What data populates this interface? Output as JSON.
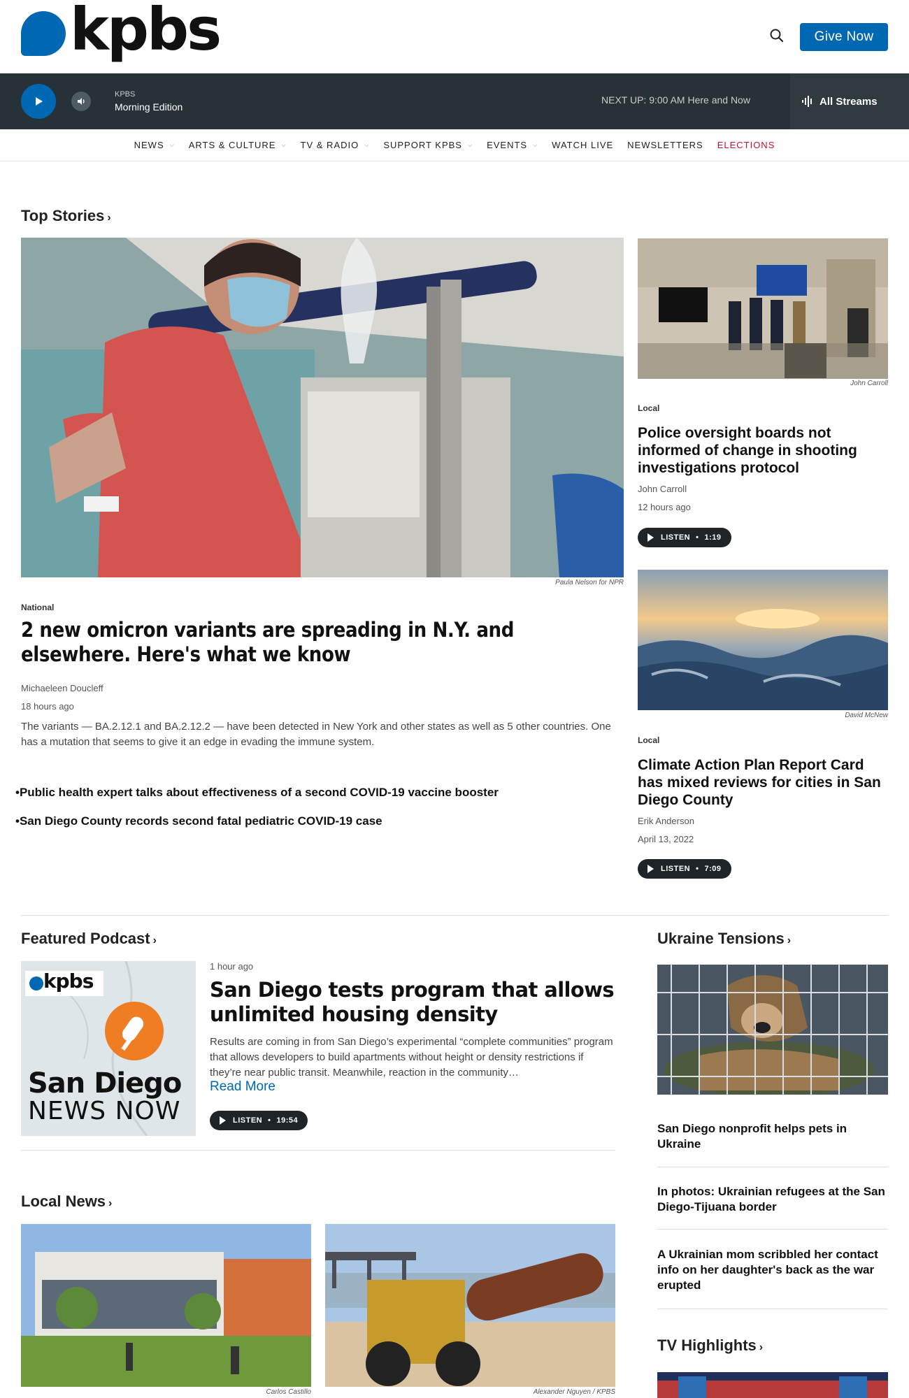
{
  "header": {
    "logo_text": "kpbs",
    "give_label": "Give Now"
  },
  "player": {
    "station": "KPBS",
    "program": "Morning Edition",
    "next_up_label": "NEXT UP:",
    "next_up_time": "9:00 AM",
    "next_up_show": "Here and Now",
    "all_streams_label": "All Streams"
  },
  "nav": {
    "items": [
      {
        "label": "NEWS",
        "has_menu": true
      },
      {
        "label": "ARTS & CULTURE",
        "has_menu": true
      },
      {
        "label": "TV & RADIO",
        "has_menu": true
      },
      {
        "label": "SUPPORT KPBS",
        "has_menu": true
      },
      {
        "label": "EVENTS",
        "has_menu": true
      },
      {
        "label": "WATCH LIVE",
        "has_menu": false
      },
      {
        "label": "NEWSLETTERS",
        "has_menu": false
      },
      {
        "label": "ELECTIONS",
        "has_menu": false
      }
    ]
  },
  "top_stories": {
    "heading": "Top Stories",
    "main": {
      "credit": "Paula Nelson for NPR",
      "tag": "National",
      "title": "2 new omicron variants are spreading in N.Y. and elsewhere. Here's what we know",
      "author": "Michaeleen Doucleff",
      "time": "18 hours ago",
      "teaser": "The variants — BA.2.12.1 and BA.2.12.2 — have been detected in New York and other states as well as 5 other countries. One has a mutation that seems to give it an edge in evading the immune system."
    },
    "related": [
      "Public health expert talks about effectiveness of a second COVID-19 vaccine booster",
      "San Diego County records second fatal pediatric COVID-19 case"
    ],
    "side": [
      {
        "credit": "John Carroll",
        "tag": "Local",
        "title": "Police oversight boards not informed of change in shooting investigations protocol",
        "author": "John Carroll",
        "time": "12 hours ago",
        "listen_label": "LISTEN",
        "duration": "1:19"
      },
      {
        "credit": "David McNew",
        "tag": "Local",
        "title": "Climate Action Plan Report Card has mixed reviews for cities in San Diego County",
        "author": "Erik Anderson",
        "time": "April 13, 2022",
        "listen_label": "LISTEN",
        "duration": "7:09"
      }
    ]
  },
  "podcast": {
    "heading": "Featured Podcast",
    "logo_text": "kpbs",
    "art_line1": "San Diego",
    "art_line2": "NEWS NOW",
    "time": "1 hour ago",
    "title": "San Diego tests program that allows unlimited housing density",
    "teaser": "Results are coming in from San Diego’s experimental “complete communities” program that allows developers to build apartments without height or density restrictions if they’re near public transit. Meanwhile, reaction in the community…",
    "read_more": "Read More",
    "listen_label": "LISTEN",
    "duration": "19:54"
  },
  "ukraine": {
    "heading": "Ukraine Tensions",
    "links": [
      "San Diego nonprofit helps pets in Ukraine",
      "In photos: Ukrainian refugees at the San Diego-Tijuana border",
      "A Ukrainian mom scribbled her contact info on her daughter's back as the war erupted"
    ]
  },
  "local_news": {
    "heading": "Local News",
    "credits": [
      "Carlos Castillo",
      "Alexander Nguyen / KPBS"
    ]
  },
  "tv": {
    "heading": "TV Highlights"
  },
  "colors": {
    "brand_blue": "#0068b3",
    "player_bg": "#263238",
    "elections_red": "#c8102e"
  }
}
